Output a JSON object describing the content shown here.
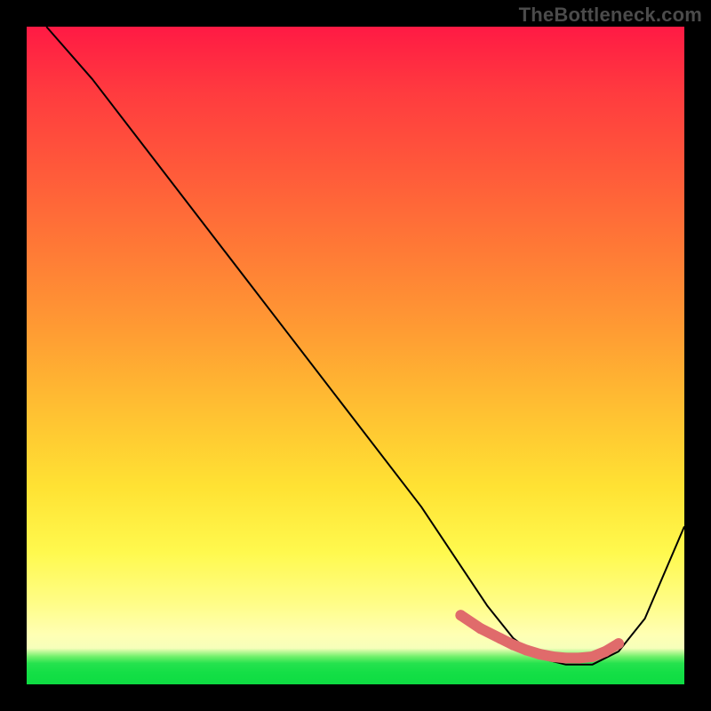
{
  "watermark": "TheBottleneck.com",
  "chart_data": {
    "type": "line",
    "title": "",
    "xlabel": "",
    "ylabel": "",
    "xlim": [
      0,
      100
    ],
    "ylim": [
      0,
      100
    ],
    "series": [
      {
        "name": "curve",
        "x": [
          3,
          10,
          20,
          30,
          40,
          50,
          60,
          66,
          70,
          74,
          78,
          82,
          86,
          90,
          94,
          100
        ],
        "y": [
          100,
          92,
          79,
          66,
          53,
          40,
          27,
          18,
          12,
          7,
          4,
          3,
          3,
          5,
          10,
          24
        ],
        "color": "#000000",
        "width": 2
      },
      {
        "name": "highlight-dots",
        "x": [
          66,
          69,
          72,
          74,
          76,
          78,
          80,
          82,
          84,
          86,
          88,
          90
        ],
        "y": [
          10.5,
          8.5,
          7,
          6,
          5.2,
          4.6,
          4.2,
          4,
          4,
          4.2,
          5,
          6.2
        ],
        "color": "#e06b6b",
        "marker_radius": 6
      }
    ],
    "grid": false,
    "legend": false
  }
}
